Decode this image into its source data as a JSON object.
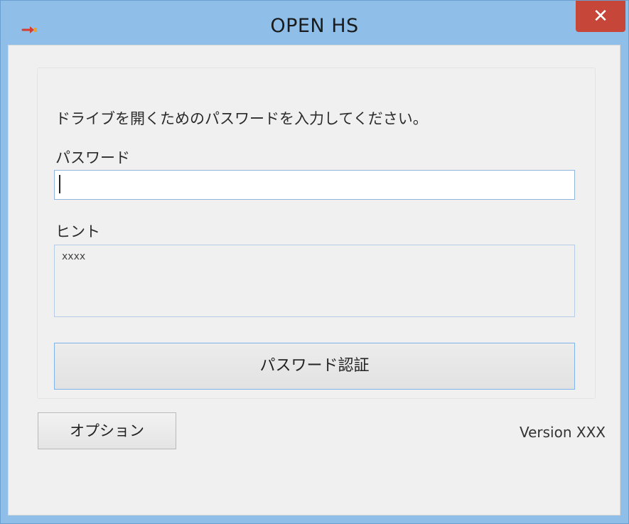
{
  "window": {
    "title": "OPEN HS",
    "close_glyph": "✕",
    "icon": "app-key-icon",
    "titlebar_color": "#8fbfe9",
    "close_color": "#c7463a"
  },
  "form": {
    "instruction": "ドライブを開くためのパスワードを入力してください。",
    "password_label": "パスワード",
    "password_value": "",
    "hint_label": "ヒント",
    "hint_value": "xxxx",
    "verify_button": "パスワード認証"
  },
  "footer": {
    "option_button": "オプション",
    "version": "Version XXX"
  }
}
